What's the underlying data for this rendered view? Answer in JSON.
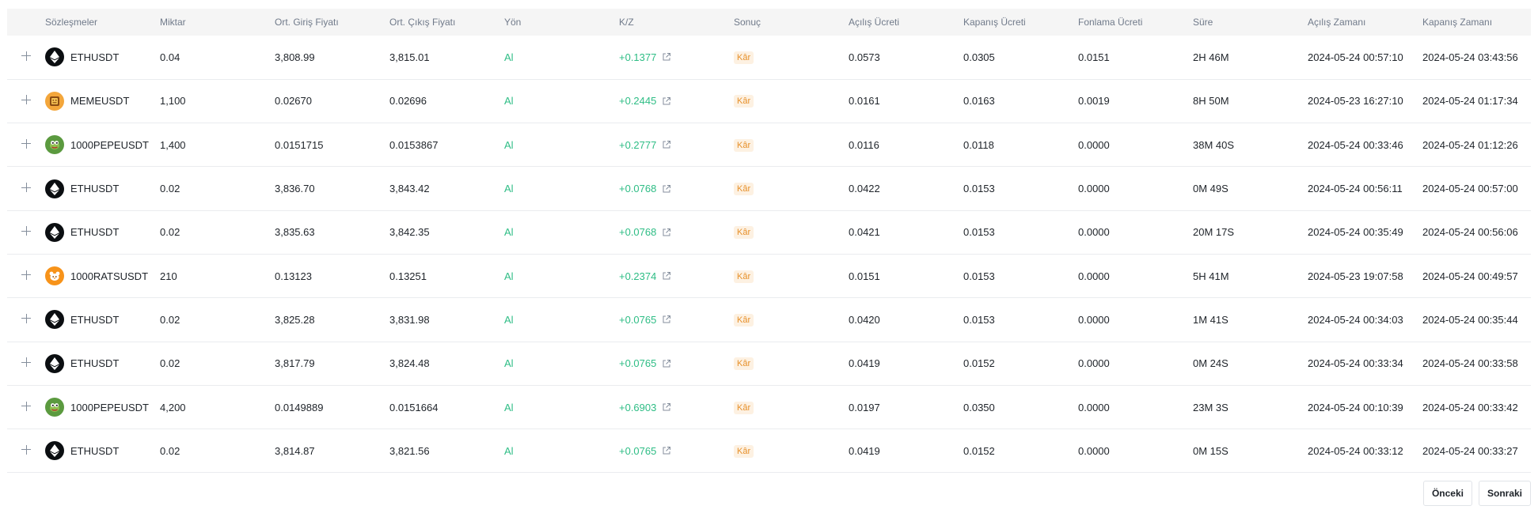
{
  "colors": {
    "profit_green": "#2ebd85",
    "badge_bg": "#fdf1e2",
    "badge_text": "#e7912c",
    "header_bg": "#f5f5f5",
    "muted_text": "#707a8a"
  },
  "table": {
    "headers": [
      "Sözleşmeler",
      "Miktar",
      "Ort. Giriş Fiyatı",
      "Ort. Çıkış Fiyatı",
      "Yön",
      "K/Z",
      "Sonuç",
      "Açılış Ücreti",
      "Kapanış Ücreti",
      "Fonlama Ücreti",
      "Süre",
      "Açılış Zamanı",
      "Kapanış Zamanı"
    ],
    "rows": [
      {
        "symbol": "ETHUSDT",
        "coin": "eth",
        "icon": "ethereum-icon",
        "qty": "0.04",
        "entry": "3,808.99",
        "exit": "3,815.01",
        "side": "Al",
        "pnl": "+0.1377",
        "result": "Kâr",
        "open_fee": "0.0573",
        "close_fee": "0.0305",
        "funding_fee": "0.0151",
        "duration": "2H 46M",
        "open_time": "2024-05-24 00:57:10",
        "close_time": "2024-05-24 03:43:56"
      },
      {
        "symbol": "MEMEUSDT",
        "coin": "meme",
        "icon": "meme-coin-icon",
        "qty": "1,100",
        "entry": "0.02670",
        "exit": "0.02696",
        "side": "Al",
        "pnl": "+0.2445",
        "result": "Kâr",
        "open_fee": "0.0161",
        "close_fee": "0.0163",
        "funding_fee": "0.0019",
        "duration": "8H 50M",
        "open_time": "2024-05-23 16:27:10",
        "close_time": "2024-05-24 01:17:34"
      },
      {
        "symbol": "1000PEPEUSDT",
        "coin": "pepe",
        "icon": "pepe-coin-icon",
        "qty": "1,400",
        "entry": "0.0151715",
        "exit": "0.0153867",
        "side": "Al",
        "pnl": "+0.2777",
        "result": "Kâr",
        "open_fee": "0.0116",
        "close_fee": "0.0118",
        "funding_fee": "0.0000",
        "duration": "38M 40S",
        "open_time": "2024-05-24 00:33:46",
        "close_time": "2024-05-24 01:12:26"
      },
      {
        "symbol": "ETHUSDT",
        "coin": "eth",
        "icon": "ethereum-icon",
        "qty": "0.02",
        "entry": "3,836.70",
        "exit": "3,843.42",
        "side": "Al",
        "pnl": "+0.0768",
        "result": "Kâr",
        "open_fee": "0.0422",
        "close_fee": "0.0153",
        "funding_fee": "0.0000",
        "duration": "0M 49S",
        "open_time": "2024-05-24 00:56:11",
        "close_time": "2024-05-24 00:57:00"
      },
      {
        "symbol": "ETHUSDT",
        "coin": "eth",
        "icon": "ethereum-icon",
        "qty": "0.02",
        "entry": "3,835.63",
        "exit": "3,842.35",
        "side": "Al",
        "pnl": "+0.0768",
        "result": "Kâr",
        "open_fee": "0.0421",
        "close_fee": "0.0153",
        "funding_fee": "0.0000",
        "duration": "20M 17S",
        "open_time": "2024-05-24 00:35:49",
        "close_time": "2024-05-24 00:56:06"
      },
      {
        "symbol": "1000RATSUSDT",
        "coin": "rats",
        "icon": "rats-coin-icon",
        "qty": "210",
        "entry": "0.13123",
        "exit": "0.13251",
        "side": "Al",
        "pnl": "+0.2374",
        "result": "Kâr",
        "open_fee": "0.0151",
        "close_fee": "0.0153",
        "funding_fee": "0.0000",
        "duration": "5H 41M",
        "open_time": "2024-05-23 19:07:58",
        "close_time": "2024-05-24 00:49:57"
      },
      {
        "symbol": "ETHUSDT",
        "coin": "eth",
        "icon": "ethereum-icon",
        "qty": "0.02",
        "entry": "3,825.28",
        "exit": "3,831.98",
        "side": "Al",
        "pnl": "+0.0765",
        "result": "Kâr",
        "open_fee": "0.0420",
        "close_fee": "0.0153",
        "funding_fee": "0.0000",
        "duration": "1M 41S",
        "open_time": "2024-05-24 00:34:03",
        "close_time": "2024-05-24 00:35:44"
      },
      {
        "symbol": "ETHUSDT",
        "coin": "eth",
        "icon": "ethereum-icon",
        "qty": "0.02",
        "entry": "3,817.79",
        "exit": "3,824.48",
        "side": "Al",
        "pnl": "+0.0765",
        "result": "Kâr",
        "open_fee": "0.0419",
        "close_fee": "0.0152",
        "funding_fee": "0.0000",
        "duration": "0M 24S",
        "open_time": "2024-05-24 00:33:34",
        "close_time": "2024-05-24 00:33:58"
      },
      {
        "symbol": "1000PEPEUSDT",
        "coin": "pepe",
        "icon": "pepe-coin-icon",
        "qty": "4,200",
        "entry": "0.0149889",
        "exit": "0.0151664",
        "side": "Al",
        "pnl": "+0.6903",
        "result": "Kâr",
        "open_fee": "0.0197",
        "close_fee": "0.0350",
        "funding_fee": "0.0000",
        "duration": "23M 3S",
        "open_time": "2024-05-24 00:10:39",
        "close_time": "2024-05-24 00:33:42"
      },
      {
        "symbol": "ETHUSDT",
        "coin": "eth",
        "icon": "ethereum-icon",
        "qty": "0.02",
        "entry": "3,814.87",
        "exit": "3,821.56",
        "side": "Al",
        "pnl": "+0.0765",
        "result": "Kâr",
        "open_fee": "0.0419",
        "close_fee": "0.0152",
        "funding_fee": "0.0000",
        "duration": "0M 15S",
        "open_time": "2024-05-24 00:33:12",
        "close_time": "2024-05-24 00:33:27"
      }
    ]
  },
  "pagination": {
    "prev_label": "Önceki",
    "next_label": "Sonraki"
  }
}
